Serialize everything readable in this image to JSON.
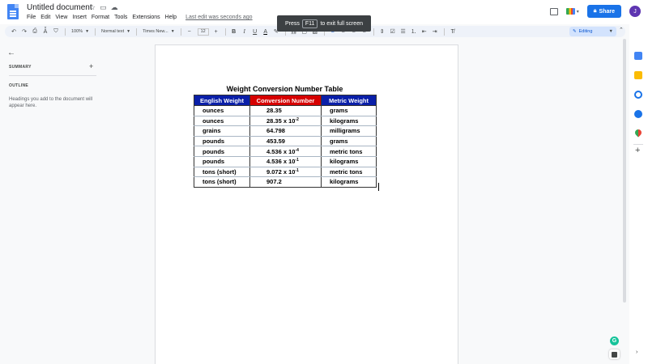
{
  "header": {
    "title": "Untitled document",
    "menu": [
      "File",
      "Edit",
      "View",
      "Insert",
      "Format",
      "Tools",
      "Extensions",
      "Help"
    ],
    "last_edit": "Last edit was seconds ago",
    "share_label": "Share",
    "avatar_initial": "J"
  },
  "fullscreen_toast": {
    "prefix": "Press",
    "key": "F11",
    "suffix": "to exit full screen"
  },
  "toolbar": {
    "zoom": "100%",
    "style": "Normal text",
    "font": "Times New...",
    "font_size": "12",
    "mode": "Editing"
  },
  "left_panel": {
    "summary_label": "SUMMARY",
    "outline_label": "OUTLINE",
    "outline_hint": "Headings you add to the document will appear here."
  },
  "document": {
    "table_title": "Weight Conversion Number Table",
    "headers": [
      {
        "label": "English Weight",
        "color": "#0a1fa8"
      },
      {
        "label": "Conversion Number",
        "color": "#d60000"
      },
      {
        "label": "Metric Weight",
        "color": "#0a1fa8"
      }
    ],
    "rows": [
      {
        "english": "ounces",
        "conv": "28.35",
        "exp": "",
        "metric": "grams"
      },
      {
        "english": "ounces",
        "conv": "28.35 x 10",
        "exp": "-2",
        "metric": "kilograms"
      },
      {
        "english": "grains",
        "conv": "64.798",
        "exp": "",
        "metric": "milligrams"
      },
      {
        "english": "pounds",
        "conv": "453.59",
        "exp": "",
        "metric": "grams"
      },
      {
        "english": "pounds",
        "conv": "4.536 x 10",
        "exp": "-4",
        "metric": "metric tons"
      },
      {
        "english": "pounds",
        "conv": "4.536 x 10",
        "exp": "-1",
        "metric": "kilograms"
      },
      {
        "english": "tons (short)",
        "conv": "9.072 x 10",
        "exp": "-1",
        "metric": "metric tons"
      },
      {
        "english": "tons (short)",
        "conv": "907.2",
        "exp": "",
        "metric": "kilograms"
      }
    ]
  }
}
